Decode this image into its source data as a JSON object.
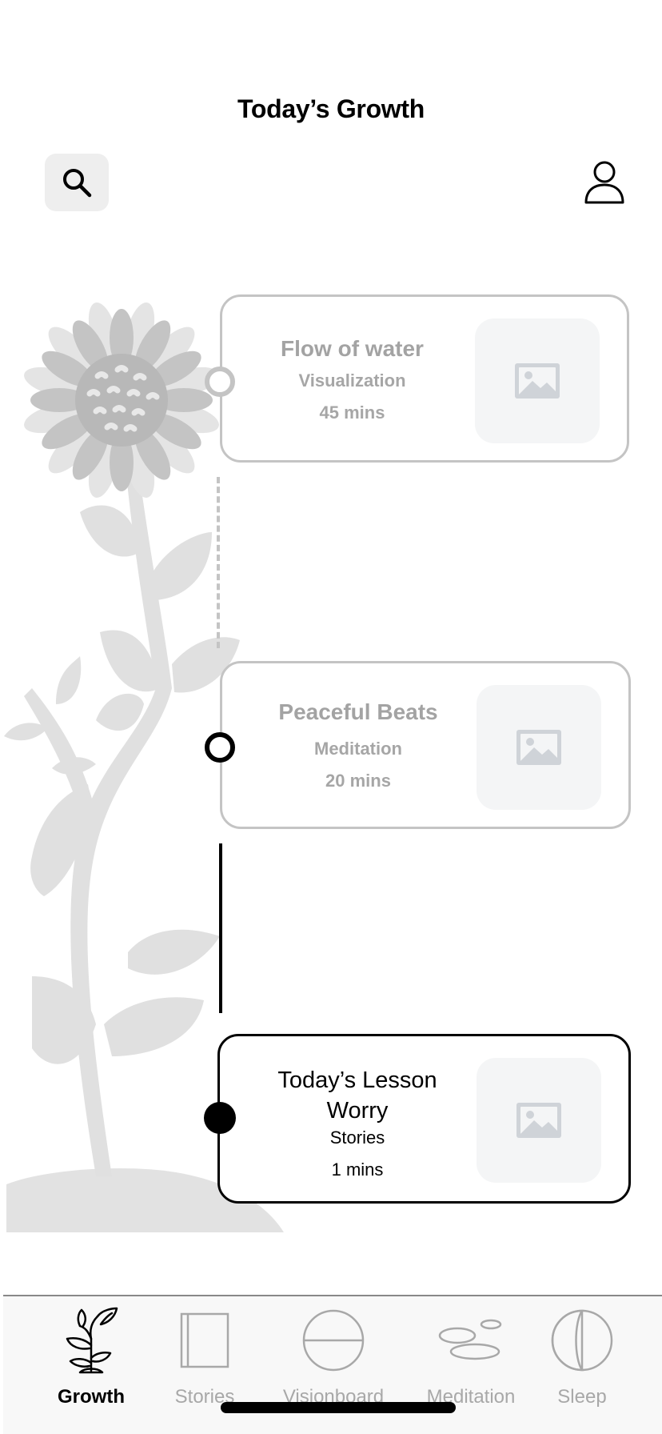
{
  "header": {
    "title": "Today’s Growth"
  },
  "icons": {
    "search": "search-icon",
    "profile": "person-icon",
    "thumb": "image-icon"
  },
  "cards": [
    {
      "title": "Flow of water",
      "category": "Visualization",
      "duration": "45 mins",
      "state": "upcoming"
    },
    {
      "title": "Peaceful Beats",
      "category": "Meditation",
      "duration": "20 mins",
      "state": "next"
    },
    {
      "title_line1": "Today’s Lesson",
      "title_line2": "Worry",
      "category": "Stories",
      "duration": "1 mins",
      "state": "current"
    }
  ],
  "tabs": [
    {
      "label": "Growth",
      "icon": "sprout-icon",
      "active": true
    },
    {
      "label": "Stories",
      "icon": "book-icon",
      "active": false
    },
    {
      "label": "Visionboard",
      "icon": "circle-line-icon",
      "active": false
    },
    {
      "label": "Meditation",
      "icon": "stones-icon",
      "active": false
    },
    {
      "label": "Sleep",
      "icon": "half-moon-icon",
      "active": false
    }
  ],
  "colors": {
    "accent": "#000000",
    "muted": "#a6a6a6",
    "plant": "#e0e0e0",
    "flower_center": "#b8b8b8"
  }
}
